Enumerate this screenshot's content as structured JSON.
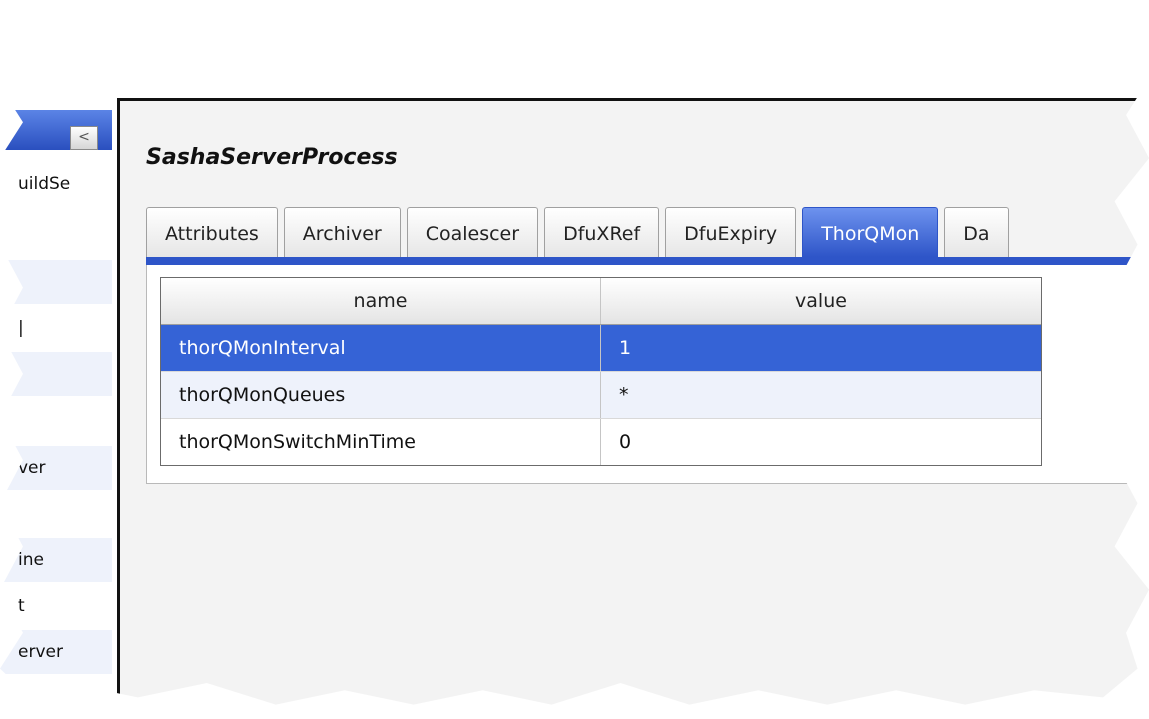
{
  "left_tree": {
    "collapse_glyph": "<",
    "rows": [
      "uildSe",
      "",
      "|",
      "",
      "ver",
      "",
      "ine",
      "t",
      "erver"
    ]
  },
  "component": {
    "title": "SashaServerProcess"
  },
  "tabs": [
    {
      "label": "Attributes",
      "active": false
    },
    {
      "label": "Archiver",
      "active": false
    },
    {
      "label": "Coalescer",
      "active": false
    },
    {
      "label": "DfuXRef",
      "active": false
    },
    {
      "label": "DfuExpiry",
      "active": false
    },
    {
      "label": "ThorQMon",
      "active": true
    },
    {
      "label": "Da",
      "active": false
    }
  ],
  "grid": {
    "columns": {
      "name": "name",
      "value": "value"
    },
    "rows": [
      {
        "name": "thorQMonInterval",
        "value": "1",
        "selected": true
      },
      {
        "name": "thorQMonQueues",
        "value": "*",
        "selected": false
      },
      {
        "name": "thorQMonSwitchMinTime",
        "value": "0",
        "selected": false
      }
    ]
  },
  "colors": {
    "accent": "#2e55c8",
    "selection": "#3563d6"
  }
}
